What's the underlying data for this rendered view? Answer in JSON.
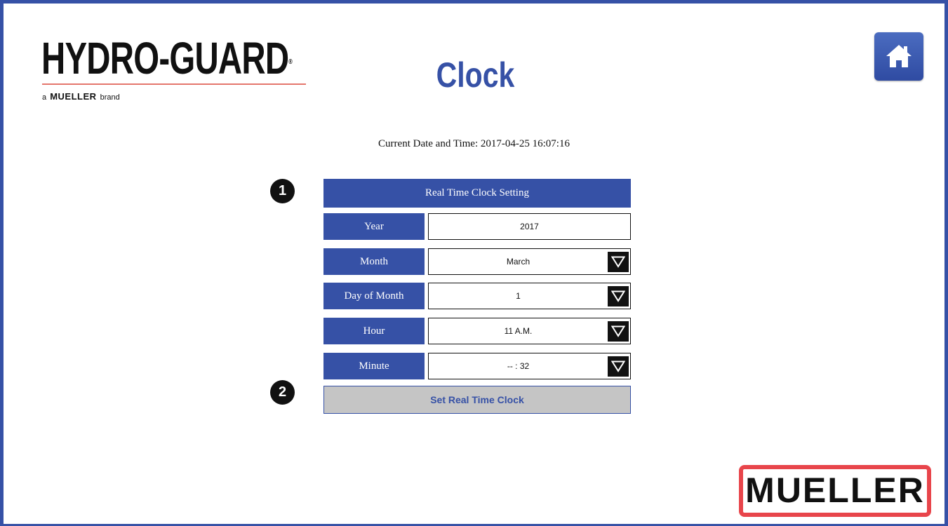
{
  "brand": {
    "logo_text": "HYDRO-GUARD",
    "logo_mark": "®",
    "tagline_prefix": "a",
    "tagline_brand": "MUELLER",
    "tagline_suffix": "brand",
    "footer_logo": "MUELLER"
  },
  "header": {
    "title": "Clock",
    "home_icon": "home-icon"
  },
  "status": {
    "current_datetime": "Current Date and Time: 2017-04-25 16:07:16"
  },
  "form": {
    "section_title": "Real Time Clock Setting",
    "fields": [
      {
        "label": "Year",
        "value": "2017",
        "type": "input"
      },
      {
        "label": "Month",
        "value": "March",
        "type": "select"
      },
      {
        "label": "Day of Month",
        "value": "1",
        "type": "select"
      },
      {
        "label": "Hour",
        "value": "11 A.M.",
        "type": "select"
      },
      {
        "label": "Minute",
        "value": "-- : 32",
        "type": "select"
      }
    ],
    "submit_label": "Set Real Time Clock"
  },
  "callouts": [
    "1",
    "2"
  ],
  "colors": {
    "primary": "#3651a6",
    "logo_rule": "#e4766c",
    "footer_border": "#e8454b",
    "button_bg": "#c5c5c5"
  }
}
